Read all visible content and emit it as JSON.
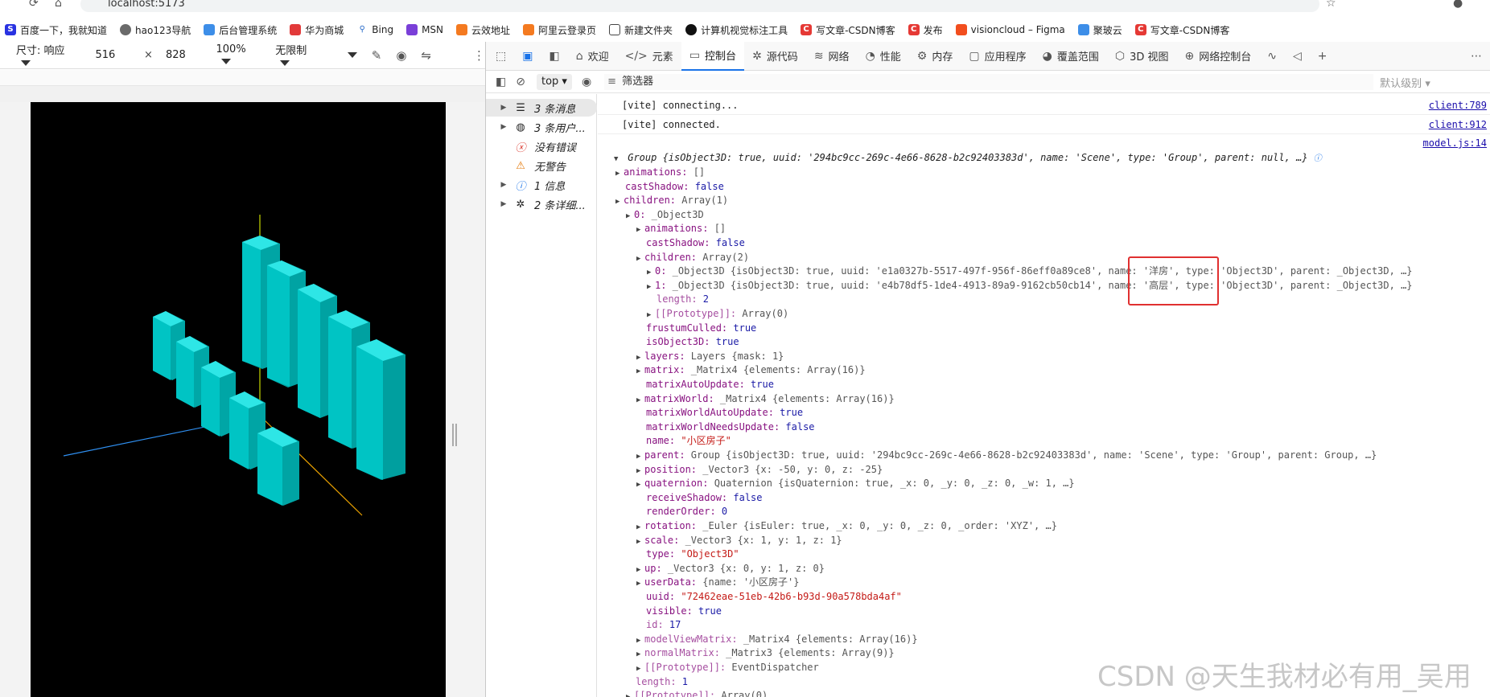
{
  "browser": {
    "url": "localhost:5173",
    "bookmarks": [
      "百度一下，我就知道",
      "hao123导航",
      "后台管理系统",
      "华为商城",
      "Bing",
      "MSN",
      "云效地址",
      "阿里云登录页",
      "新建文件夹",
      "计算机视觉标注工具",
      "写文章-CSDN博客",
      "发布",
      "visioncloud – Figma",
      "聚玻云",
      "写文章-CSDN博客"
    ]
  },
  "device_toolbar": {
    "dimension_label": "尺寸: 响应",
    "width": "516",
    "times": "×",
    "height": "828",
    "zoom": "100%",
    "throttle": "无限制"
  },
  "devtools": {
    "tabs": [
      "欢迎",
      "元素",
      "控制台",
      "源代码",
      "网络",
      "性能",
      "内存",
      "应用程序",
      "覆盖范围",
      "3D 视图",
      "网络控制台"
    ],
    "active_tab": "控制台",
    "context": "top",
    "filter_placeholder": "筛选器",
    "default_level": "默认级别"
  },
  "console_sidebar": {
    "items": [
      {
        "label": "3 条消息",
        "icon": "list-icon"
      },
      {
        "label": "3 条用户...",
        "icon": "user-icon"
      },
      {
        "label": "没有错误",
        "icon": "error-icon"
      },
      {
        "label": "无警告",
        "icon": "warning-icon"
      },
      {
        "label": "1 信息",
        "icon": "info-icon"
      },
      {
        "label": "2 条详细...",
        "icon": "bug-icon"
      }
    ]
  },
  "console": {
    "msg1": "[vite] connecting...",
    "src1": "client:789",
    "msg2": "[vite] connected.",
    "src2": "client:912",
    "src3": "model.js:14",
    "group_line": "Group {isObject3D: true, uuid: '294bc9cc-269c-4e66-8628-b2c92403383d', name: 'Scene', type: 'Group', parent: null, …}",
    "rows": [
      "animations: []",
      "castShadow: false",
      "children: Array(1)",
      "0: _Object3D",
      "animations: []",
      "castShadow: false",
      "children: Array(2)",
      "0: _Object3D {isObject3D: true, uuid: 'e1a0327b-5517-497f-956f-86eff0a89ce8', name: '洋房', type: 'Object3D', parent: _Object3D, …}",
      "1: _Object3D {isObject3D: true, uuid: 'e4b78df5-1de4-4913-89a9-9162cb50cb14', name: '高层', type: 'Object3D', parent: _Object3D, …}",
      "length: 2",
      "[[Prototype]]: Array(0)",
      "frustumCulled: true",
      "isObject3D: true",
      "layers: Layers {mask: 1}",
      "matrix: _Matrix4 {elements: Array(16)}",
      "matrixAutoUpdate: true",
      "matrixWorld: _Matrix4 {elements: Array(16)}",
      "matrixWorldAutoUpdate: true",
      "matrixWorldNeedsUpdate: false",
      "name: \"小区房子\"",
      "parent: Group {isObject3D: true, uuid: '294bc9cc-269c-4e66-8628-b2c92403383d', name: 'Scene', type: 'Group', parent: Group, …}",
      "position: _Vector3 {x: -50, y: 0, z: -25}",
      "quaternion: Quaternion {isQuaternion: true, _x: 0, _y: 0, _z: 0, _w: 1, …}",
      "receiveShadow: false",
      "renderOrder: 0",
      "rotation: _Euler {isEuler: true, _x: 0, _y: 0, _z: 0, _order: 'XYZ', …}",
      "scale: _Vector3 {x: 1, y: 1, z: 1}",
      "type: \"Object3D\"",
      "up: _Vector3 {x: 0, y: 1, z: 0}",
      "userData: {name: '小区房子'}",
      "uuid: \"72462eae-51eb-42b6-b93d-90a578bda4af\"",
      "visible: true",
      "id: 17",
      "modelViewMatrix: _Matrix4 {elements: Array(16)}",
      "normalMatrix: _Matrix3 {elements: Array(9)}",
      "[[Prototype]]: EventDispatcher",
      "length: 1",
      "[[Prototype]]: Array(0)"
    ]
  },
  "watermark": "CSDN @天生我材必有用_吴用",
  "colors": {
    "accent": "#1a73e8",
    "box": "#00c8c8",
    "highlight": "#e03030"
  }
}
